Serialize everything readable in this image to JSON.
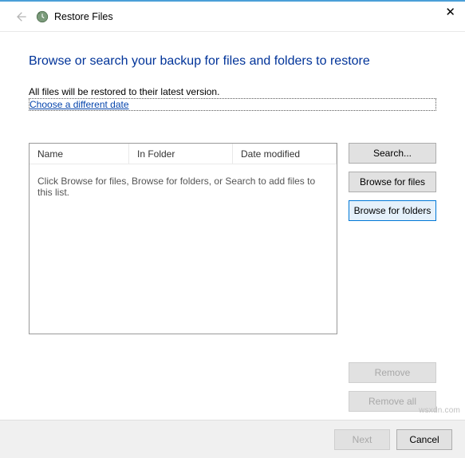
{
  "title": "Restore Files",
  "heading": "Browse or search your backup for files and folders to restore",
  "info": "All files will be restored to their latest version.",
  "link": "Choose a different date",
  "columns": {
    "name": "Name",
    "folder": "In Folder",
    "date": "Date modified"
  },
  "placeholder": "Click Browse for files, Browse for folders, or Search to add files to this list.",
  "buttons": {
    "search": "Search...",
    "browse_files": "Browse for files",
    "browse_folders": "Browse for folders",
    "remove": "Remove",
    "remove_all": "Remove all",
    "next": "Next",
    "cancel": "Cancel"
  },
  "watermark": "wsxdn.com"
}
